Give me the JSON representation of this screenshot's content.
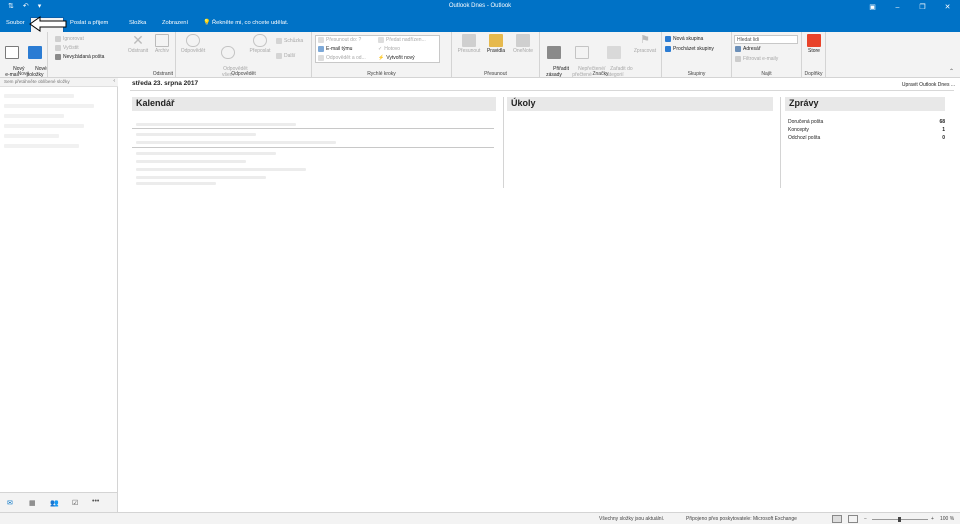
{
  "window": {
    "title": "Outlook Dnes  -  Outlook"
  },
  "qat": {
    "icons": [
      "send-receive-icon",
      "undo-icon",
      "customize-qat-icon"
    ]
  },
  "tabs": [
    {
      "label": "Soubor"
    },
    {
      "label": "Domů"
    },
    {
      "label": "Poslat a přijem"
    },
    {
      "label": "Složka"
    },
    {
      "label": "Zobrazení"
    }
  ],
  "tell_me": "Řekněte mi, co chcete udělat.",
  "ribbon": {
    "new": {
      "new_email": "Nový\ne-mail",
      "new_items": "Nové\npoložky",
      "label": "Nové"
    },
    "delete": {
      "ignore": "Ignorovat",
      "cleanup": "Vyčistit",
      "junk": "Nevyžádaná pošta",
      "delete": "Odstranit",
      "archive": "Archiv",
      "label": "Odstranit"
    },
    "respond": {
      "reply": "Odpovědět",
      "reply_all": "Odpovědět\nvšem",
      "forward": "Přeposlat",
      "meeting": "Schůzka",
      "more": "Další",
      "label": "Odpovědět"
    },
    "quick_steps": {
      "move_to": "Přesunout do: ?",
      "to_manager": "Předat nadřízen...",
      "team_email": "E-mail týmu",
      "done": "Hotovo",
      "reply_delete": "Odpovědět a od...",
      "create_new": "Vytvořit nový",
      "label": "Rychlé kroky"
    },
    "move": {
      "move": "Přesunout",
      "rules": "Pravidla",
      "onenote": "OneNote",
      "label": "Přesunout"
    },
    "tags": {
      "assign": "Přiřadit\nzásady",
      "unread": "Nepřečtené/\npřečtené",
      "categorize": "Zařadit do\nkategorií",
      "followup": "Zpracovat",
      "label": "Značky"
    },
    "groups": {
      "new_group": "Nová skupina",
      "browse_groups": "Procházet skupiny",
      "label": "Skupiny"
    },
    "find": {
      "search_people": "Hledat lidi",
      "address_book": "Adresář",
      "filter_email": "Filtrovat e-maily",
      "label": "Najít"
    },
    "addins": {
      "store": "Store",
      "label": "Doplňky"
    }
  },
  "nav": {
    "hint": "Sem přetáhněte oblíbené složky"
  },
  "bottom_nav": {
    "icons": [
      "mail-icon",
      "calendar-icon",
      "people-icon",
      "tasks-icon",
      "more-icon"
    ],
    "more": "•••"
  },
  "main": {
    "date": "středa 23. srpna 2017",
    "customize": "Upravit Outlook Dnes ...",
    "calendar_title": "Kalendář",
    "tasks_title": "Úkoly",
    "messages_title": "Zprávy",
    "messages": [
      {
        "label": "Doručená pošta",
        "count": "68"
      },
      {
        "label": "Koncepty",
        "count": "1"
      },
      {
        "label": "Odchozí pošta",
        "count": "0"
      }
    ]
  },
  "status": {
    "left": "Všechny složky jsou aktuální.",
    "connected": "Připojeno přes poskytovatele: Microsoft Exchange",
    "zoom": "100 %"
  },
  "colors": {
    "brand": "#0072c6",
    "ribbon_bg": "#f3f3f3"
  }
}
